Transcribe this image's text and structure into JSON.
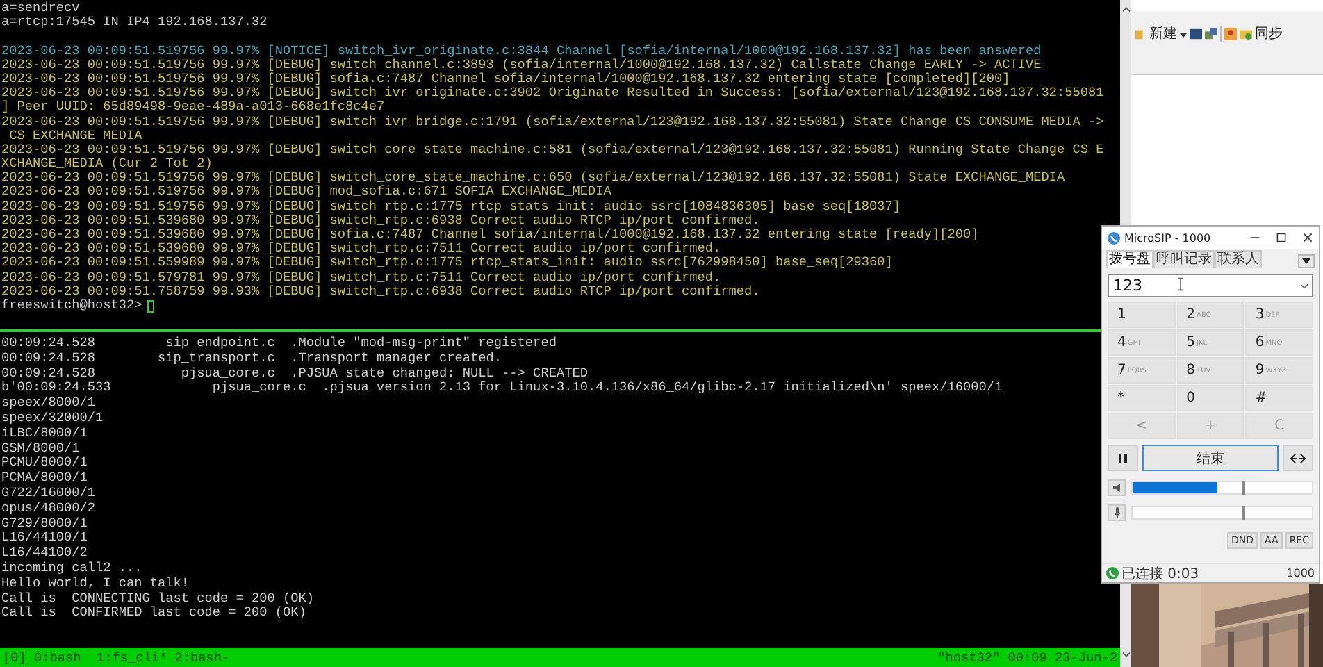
{
  "terminal_top": {
    "lines": [
      {
        "kind": "plain",
        "text": "a=sendrecv"
      },
      {
        "kind": "plain",
        "text": "a=rtcp:17545 IN IP4 192.168.137.32"
      },
      {
        "kind": "blank"
      },
      {
        "kind": "notice",
        "text": "2023-06-23 00:09:51.519756 99.97% [NOTICE] switch_ivr_originate.c:3844 Channel [sofia/internal/1000@192.168.137.32] has been answered"
      },
      {
        "kind": "debug",
        "text": "2023-06-23 00:09:51.519756 99.97% [DEBUG] switch_channel.c:3893 (sofia/internal/1000@192.168.137.32) Callstate Change EARLY -> ACTIVE"
      },
      {
        "kind": "debug",
        "text": "2023-06-23 00:09:51.519756 99.97% [DEBUG] sofia.c:7487 Channel sofia/internal/1000@192.168.137.32 entering state [completed][200]"
      },
      {
        "kind": "debug",
        "text": "2023-06-23 00:09:51.519756 99.97% [DEBUG] switch_ivr_originate.c:3902 Originate Resulted in Success: [sofia/external/123@192.168.137.32:55081"
      },
      {
        "kind": "debug",
        "text": "] Peer UUID: 65d89498-9eae-489a-a013-668e1fc8c4e7"
      },
      {
        "kind": "debug",
        "text": "2023-06-23 00:09:51.519756 99.97% [DEBUG] switch_ivr_bridge.c:1791 (sofia/external/123@192.168.137.32:55081) State Change CS_CONSUME_MEDIA ->"
      },
      {
        "kind": "debug",
        "text": " CS_EXCHANGE_MEDIA"
      },
      {
        "kind": "debug",
        "text": "2023-06-23 00:09:51.519756 99.97% [DEBUG] switch_core_state_machine.c:581 (sofia/external/123@192.168.137.32:55081) Running State Change CS_E"
      },
      {
        "kind": "debug",
        "text": "XCHANGE_MEDIA (Cur 2 Tot 2)"
      },
      {
        "kind": "debug",
        "text": "2023-06-23 00:09:51.519756 99.97% [DEBUG] switch_core_state_machine.c:650 (sofia/external/123@192.168.137.32:55081) State EXCHANGE_MEDIA"
      },
      {
        "kind": "debug",
        "text": "2023-06-23 00:09:51.519756 99.97% [DEBUG] mod_sofia.c:671 SOFIA EXCHANGE_MEDIA"
      },
      {
        "kind": "debug",
        "text": "2023-06-23 00:09:51.519756 99.97% [DEBUG] switch_rtp.c:1775 rtcp_stats_init: audio ssrc[1084836305] base_seq[18037]"
      },
      {
        "kind": "debug",
        "text": "2023-06-23 00:09:51.539680 99.97% [DEBUG] switch_rtp.c:6938 Correct audio RTCP ip/port confirmed."
      },
      {
        "kind": "debug",
        "text": "2023-06-23 00:09:51.539680 99.97% [DEBUG] sofia.c:7487 Channel sofia/internal/1000@192.168.137.32 entering state [ready][200]"
      },
      {
        "kind": "debug",
        "text": "2023-06-23 00:09:51.539680 99.97% [DEBUG] switch_rtp.c:7511 Correct audio ip/port confirmed."
      },
      {
        "kind": "debug",
        "text": "2023-06-23 00:09:51.559989 99.97% [DEBUG] switch_rtp.c:1775 rtcp_stats_init: audio ssrc[762998450] base_seq[29360]"
      },
      {
        "kind": "debug",
        "text": "2023-06-23 00:09:51.579781 99.97% [DEBUG] switch_rtp.c:7511 Correct audio ip/port confirmed."
      },
      {
        "kind": "debug",
        "text": "2023-06-23 00:09:51.758759 99.93% [DEBUG] switch_rtp.c:6938 Correct audio RTCP ip/port confirmed."
      }
    ],
    "prompt": "freeswitch@host32>"
  },
  "terminal_bottom": {
    "lines": [
      "00:09:24.528         sip_endpoint.c  .Module \"mod-msg-print\" registered",
      "00:09:24.528        sip_transport.c  .Transport manager created.",
      "00:09:24.528           pjsua_core.c  .PJSUA state changed: NULL --> CREATED",
      "b'00:09:24.533             pjsua_core.c  .pjsua version 2.13 for Linux-3.10.4.136/x86_64/glibc-2.17 initialized\\n' speex/16000/1",
      "speex/8000/1",
      "speex/32000/1",
      "iLBC/8000/1",
      "GSM/8000/1",
      "PCMU/8000/1",
      "PCMA/8000/1",
      "G722/16000/1",
      "opus/48000/2",
      "G729/8000/1",
      "L16/44100/1",
      "L16/44100/2",
      "incoming call2 ...",
      "Hello world, I can talk!",
      "Call is  CONNECTING last code = 200 (OK)",
      "Call is  CONFIRMED last code = 200 (OK)"
    ]
  },
  "status_bar": {
    "windows": "[0] 0:bash  1:fs_cli* 2:bash-",
    "host": "\"host32\" 00:09 23-Jun-2"
  },
  "background_app": {
    "toolbar": {
      "new_label": "新建",
      "sync_label": "同步"
    }
  },
  "microsip": {
    "title": "MicroSIP - 1000",
    "tabs": [
      {
        "label": "拨号盘",
        "selected": true
      },
      {
        "label": "呼叫记录",
        "selected": false
      },
      {
        "label": "联系人",
        "selected": false
      }
    ],
    "number": "123",
    "keys": [
      {
        "digit": "1"
      },
      {
        "digit": "2",
        "letters": "ABC"
      },
      {
        "digit": "3",
        "letters": "DEF"
      },
      {
        "digit": "4",
        "letters": "GHI"
      },
      {
        "digit": "5",
        "letters": "JKL"
      },
      {
        "digit": "6",
        "letters": "MNO"
      },
      {
        "digit": "7",
        "letters": "PQRS"
      },
      {
        "digit": "8",
        "letters": "TUV"
      },
      {
        "digit": "9",
        "letters": "WXYZ"
      },
      {
        "digit": "*"
      },
      {
        "digit": "0"
      },
      {
        "digit": "#"
      }
    ],
    "edit_keys": [
      "<",
      "+",
      "C"
    ],
    "end_call": "结束",
    "sliders": [
      {
        "kind": "speaker",
        "meter": {
          "level": 0.47
        },
        "volume": {
          "level": 0.62
        }
      },
      {
        "kind": "microphone",
        "volume": {
          "level": 0.62
        }
      }
    ],
    "toggles": [
      "DND",
      "AA",
      "REC"
    ],
    "status": {
      "text": "已连接 0:03",
      "account": "1000"
    }
  }
}
